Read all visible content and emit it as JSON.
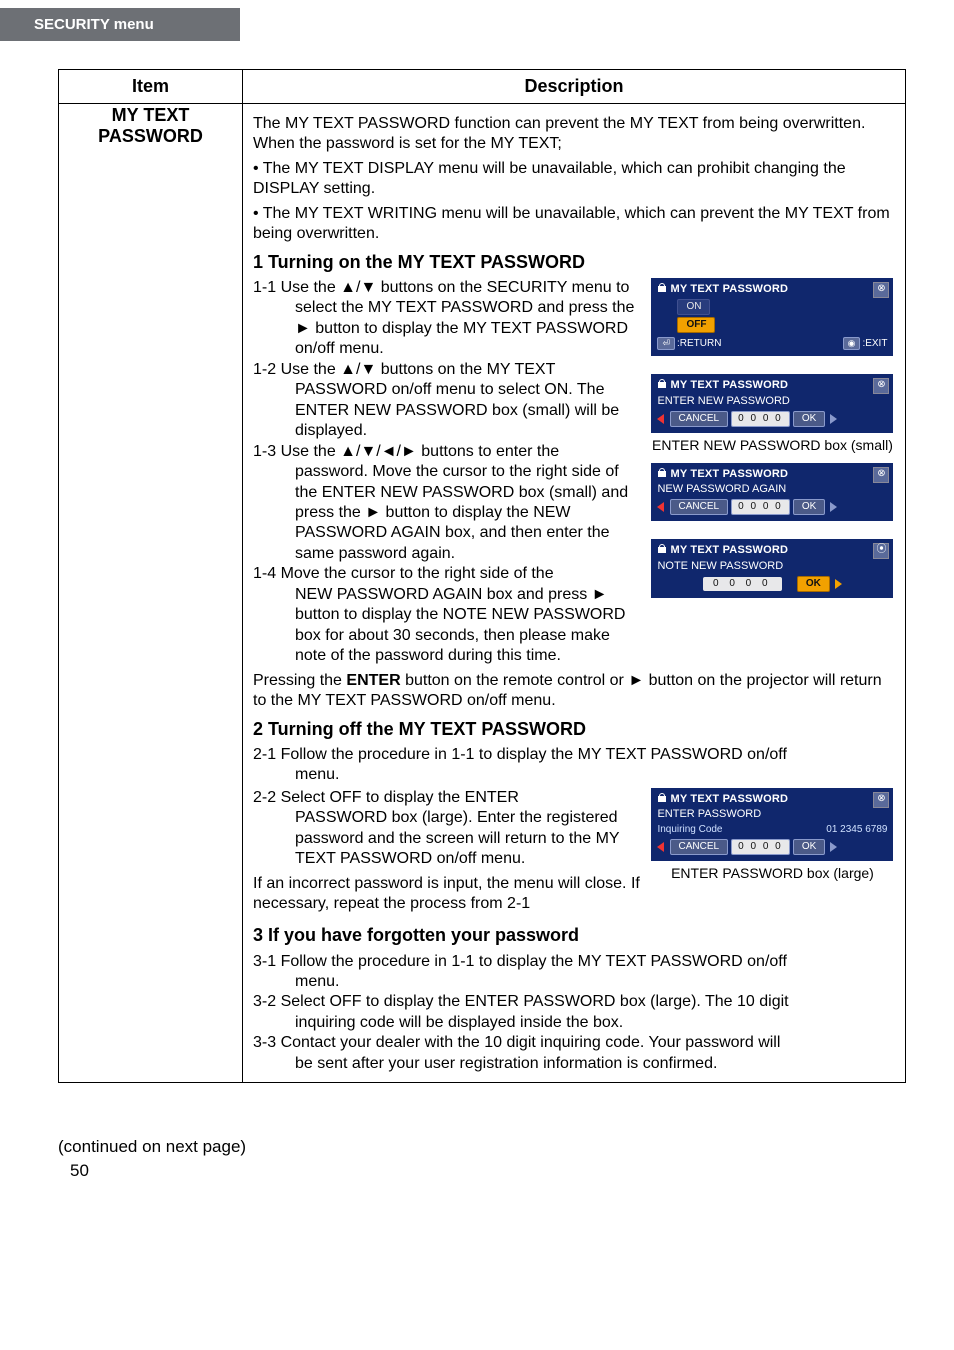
{
  "tab": "SECURITY menu",
  "table": {
    "head_item": "Item",
    "head_desc": "Description",
    "item_name_1": "MY TEXT",
    "item_name_2": "PASSWORD",
    "intro1": "The MY TEXT PASSWORD function can prevent the MY TEXT from being overwritten. When the password is set for the MY TEXT;",
    "intro2": "• The MY TEXT DISPLAY menu will be unavailable, which can prohibit changing the DISPLAY setting.",
    "intro3": "• The MY TEXT WRITING menu will be unavailable, which can prevent the MY TEXT from being overwritten.",
    "h1": "1 Turning on the MY TEXT PASSWORD",
    "s11a": "1-1 Use the ▲/▼ buttons on the SECURITY menu to",
    "s11b": "select the MY TEXT PASSWORD and press the ► button to display the MY TEXT PASSWORD on/off menu.",
    "s12a": "1-2 Use the ▲/▼ buttons on the MY TEXT",
    "s12b": "PASSWORD on/off menu to select ON. The ENTER NEW PASSWORD box (small) will be displayed.",
    "s13a": "1-3 Use the ▲/▼/◄/► buttons to enter the",
    "s13b": "password. Move the cursor to the right side of the ENTER NEW PASSWORD box (small) and press the ► button to display the NEW PASSWORD AGAIN box, and then enter the same password again.",
    "s14a": "1-4 Move the cursor to the right side of the",
    "s14b": "NEW PASSWORD AGAIN box and press ► button to display the NOTE NEW PASSWORD box for about 30 seconds, then please make note of the password during this time.",
    "s1press": "Pressing the ENTER button on the remote control or ► button on the projector will return to the MY TEXT PASSWORD on/off menu.",
    "enter_word": "ENTER",
    "h2": "2 Turning off the MY TEXT PASSWORD",
    "s21a": "2-1 Follow the procedure in 1-1 to display the MY TEXT PASSWORD on/off",
    "s21b": "menu.",
    "s22a": "2-2 Select OFF to display the ENTER",
    "s22b": "PASSWORD box (large). Enter the registered password and the screen will return to the MY TEXT PASSWORD on/off menu.",
    "s2inc": "If an incorrect password is input, the menu will close. If necessary, repeat the process from 2-1",
    "h3": "3 If you have forgotten your password",
    "s31a": "3-1 Follow the procedure in 1-1 to display the MY TEXT PASSWORD on/off",
    "s31b": "menu.",
    "s32a": "3-2 Select OFF to display the ENTER PASSWORD box (large). The 10 digit",
    "s32b": "inquiring code will be displayed inside the box.",
    "s33a": "3-3 Contact your dealer with the 10 digit inquiring code. Your password will",
    "s33b": "be sent after your user registration information is confirmed."
  },
  "osd": {
    "title": "MY TEXT PASSWORD",
    "on": "ON",
    "off": "OFF",
    "return": ":RETURN",
    "exit": ":EXIT",
    "enter_new": "ENTER NEW PASSWORD",
    "new_again": "NEW PASSWORD AGAIN",
    "note_new": "NOTE NEW PASSWORD",
    "enter_pw": "ENTER PASSWORD",
    "inq_label": "Inquiring Code",
    "inq_code": "01 2345 6789",
    "cancel": "CANCEL",
    "ok": "OK",
    "zeros": "0 0 0 0",
    "cap_small": "ENTER NEW PASSWORD box (small)",
    "cap_large": "ENTER PASSWORD box (large)"
  },
  "continued": "(continued on next page)",
  "pagenum": "50"
}
